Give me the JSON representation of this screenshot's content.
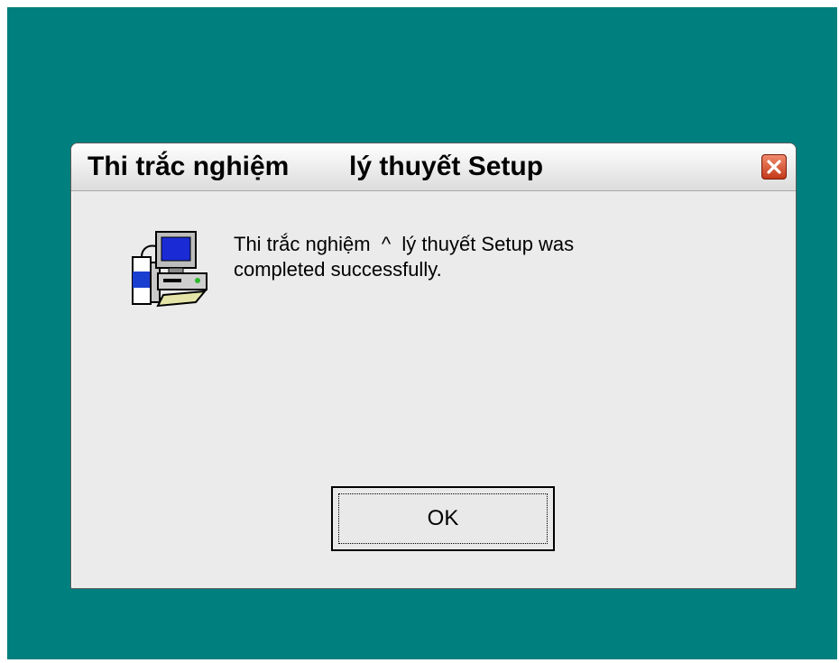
{
  "window": {
    "title": "Thi trắc nghiệm        lý thuyết Setup"
  },
  "dialog": {
    "message": "Thi trắc nghiệm  ^  lý thuyết Setup was\ncompleted successfully.",
    "ok_label": "OK"
  },
  "icons": {
    "close": "close-icon",
    "setup": "computer-setup-icon"
  },
  "colors": {
    "desktop": "#007f7f",
    "dialog_bg": "#ebebeb",
    "close_button": "#d0502e"
  }
}
